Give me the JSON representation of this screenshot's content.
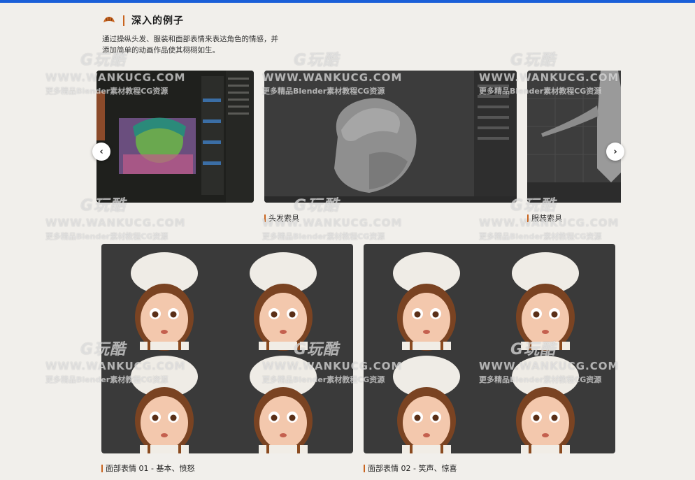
{
  "section": {
    "title": "深入的例子",
    "icon": "croissant-icon",
    "description": "通过操纵头发、服装和面部表情来表达角色的情感，并添加简单的动画作品使其栩栩如生。"
  },
  "carousel": {
    "prev_icon": "‹",
    "next_icon": "›",
    "slides": [
      {
        "caption": ""
      },
      {
        "caption": "头发索具"
      },
      {
        "caption": "服装索具"
      }
    ]
  },
  "panels": [
    {
      "caption": "面部表情 01 - 基本、愤怒"
    },
    {
      "caption": "面部表情 02 - 笑声、惊喜"
    }
  ],
  "watermark": {
    "logo": "G玩酷",
    "url": "WWW.WANKUCG.COM",
    "sub": "更多精品Blender素材教程CG资源"
  },
  "colors": {
    "accent": "#c9641f",
    "top_bar": "#1a5fd8",
    "background": "#f1efeb"
  }
}
